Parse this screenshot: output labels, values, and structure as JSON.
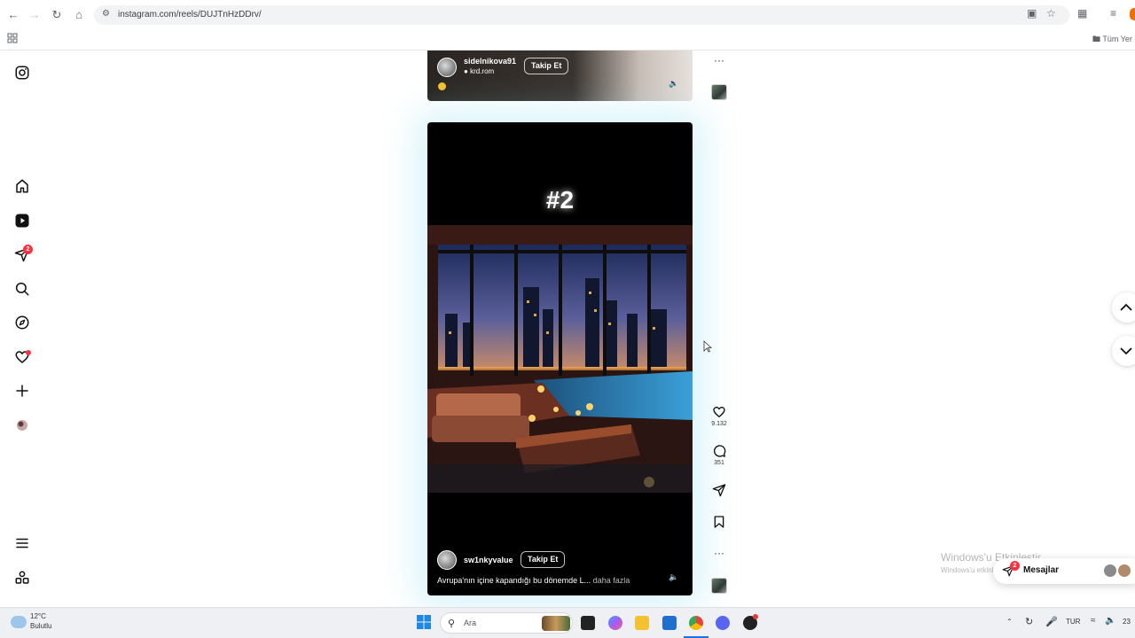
{
  "browser": {
    "url": "instagram.com/reels/DUJTnHzDDrv/",
    "bookmarks_label": "Tüm Yer"
  },
  "sidebar": {
    "notifications_badge": "2"
  },
  "reel_prev": {
    "username": "sidelnikova91",
    "audio": "krd.rom",
    "follow_label": "Takip Et"
  },
  "reel_current": {
    "overlay_text": "#2",
    "username": "sw1nkyvalue",
    "follow_label": "Takip Et",
    "caption": "Avrupa'nın içine kapandığı bu dönemde L...",
    "more_label": "daha fazla"
  },
  "actions": {
    "likes": "9.132",
    "comments": "351"
  },
  "windows_activation": {
    "title": "Windows'u Etkinleştir",
    "subtitle": "Windows'u etkinleştirmek için Ayarlar'a gidin."
  },
  "messages": {
    "label": "Mesajlar",
    "badge": "2"
  },
  "taskbar": {
    "temperature": "12°C",
    "condition": "Bulutlu",
    "search_placeholder": "Ara",
    "language": "TUR",
    "clock": "23"
  },
  "colors": {
    "accent_red": "#ff3040",
    "glow": "#8cdcf0"
  }
}
